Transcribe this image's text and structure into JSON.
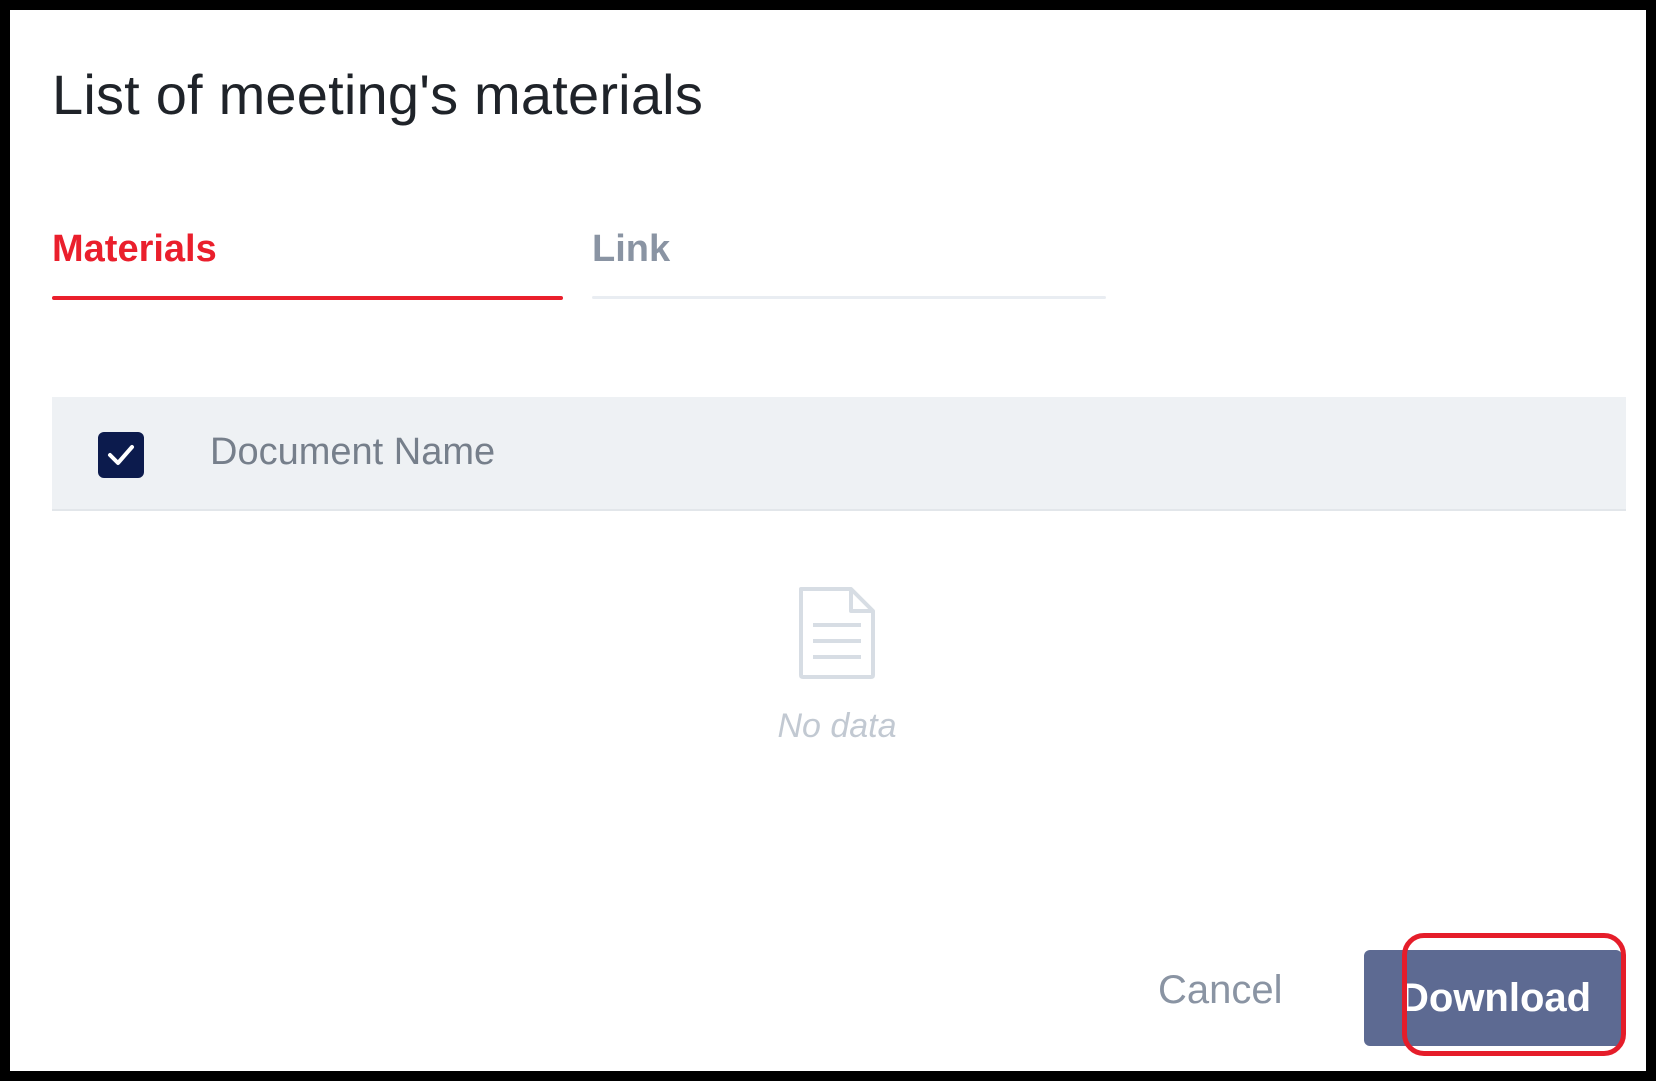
{
  "dialog": {
    "title": "List of meeting's materials"
  },
  "tabs": [
    {
      "label": "Materials",
      "active": true
    },
    {
      "label": "Link",
      "active": false
    }
  ],
  "table": {
    "select_all_checked": true,
    "columns": [
      "Document Name"
    ],
    "rows": [],
    "empty_text": "No data"
  },
  "footer": {
    "cancel_label": "Cancel",
    "download_label": "Download"
  },
  "colors": {
    "accent_red": "#ea1f2c",
    "primary_button": "#5d6a92",
    "checkbox_fill": "#0c1b4d",
    "highlight_outline": "#e51d2a"
  },
  "icons": {
    "checkbox": "check-icon",
    "empty_state": "document-icon"
  }
}
